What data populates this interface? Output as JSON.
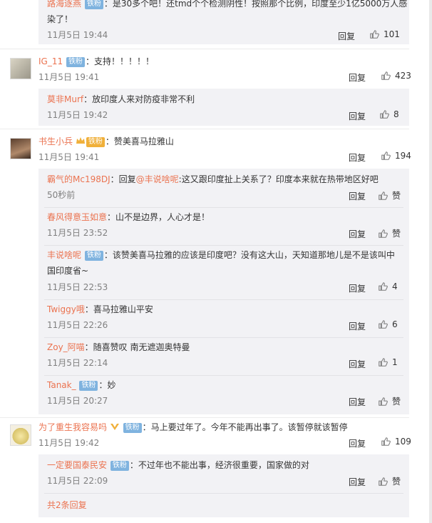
{
  "comments": [
    {
      "user": "路海逐燕",
      "badge": "铁粉",
      "text": "：是30多个吧！还tmd个个检测阴性！按照那个比例，印度至少1亿5000万人感",
      "text2": "染了！",
      "time": "11月5日 19:44",
      "reply": "回复",
      "likes": "101"
    },
    {
      "user": "IG_11",
      "badge": "铁粉",
      "text": "：支持！！！！！",
      "time": "11月5日 19:41",
      "reply": "回复",
      "likes": "423",
      "subs": [
        {
          "user": "莫非Murf",
          "text": "：放印度人来对防疫非常不利",
          "time": "11月5日 19:42",
          "reply": "回复",
          "likes": "8"
        }
      ]
    },
    {
      "user": "书生小兵",
      "badge": "铁粉",
      "text": "：赞美喜马拉雅山",
      "time": "11月5日 19:41",
      "reply": "回复",
      "likes": "194",
      "subs": [
        {
          "user": "霸气的Mc198DJ",
          "text": "：回复",
          "mention": "@丰说啥呢",
          "text_after": ":这又跟印度扯上关系了？印度本来就在热带地区好吧",
          "time": "50秒前",
          "reply": "回复",
          "likes": "赞"
        },
        {
          "user": "春风得意玉如意",
          "text": "：山不是边界，人心才是！",
          "time": "11月5日 23:52",
          "reply": "回复",
          "likes": "赞"
        },
        {
          "user": "丰说啥呢",
          "badge": "铁粉",
          "text": "：该赞美喜马拉雅的应该是印度吧？没有这大山，天知道那地儿是不是该叫中",
          "text2": "国印度省~",
          "time": "11月5日 22:53",
          "reply": "回复",
          "likes": "4"
        },
        {
          "user": "Twiggy哦",
          "text": "：喜马拉雅山平安",
          "time": "11月5日 22:26",
          "reply": "回复",
          "likes": "6"
        },
        {
          "user": "Zoy_阿喵",
          "text": "：随喜赞叹 南无遮迦奥特曼",
          "time": "11月5日 22:14",
          "reply": "回复",
          "likes": "1"
        },
        {
          "user": "Tanak_",
          "badge": "铁粉",
          "text": "：妙",
          "time": "11月5日 20:27",
          "reply": "回复",
          "likes": "赞"
        }
      ]
    },
    {
      "user": "为了重生我容易吗",
      "badge": "铁粉",
      "text": "：马上要过年了。今年不能再出事了。该暂停就该暂停",
      "time": "11月5日 19:42",
      "reply": "回复",
      "likes": "109",
      "subs": [
        {
          "user": "一定要国泰民安",
          "badge": "铁粉",
          "text": "：不过年也不能出事，经济很重要，国家做的对",
          "time": "11月5日 22:09",
          "reply": "回复",
          "likes": "赞"
        }
      ],
      "more": "共2条回复"
    }
  ],
  "colors": {
    "name": "#eb7350",
    "badge": "#7fb3df",
    "sub_bg": "#f2f2f5"
  }
}
